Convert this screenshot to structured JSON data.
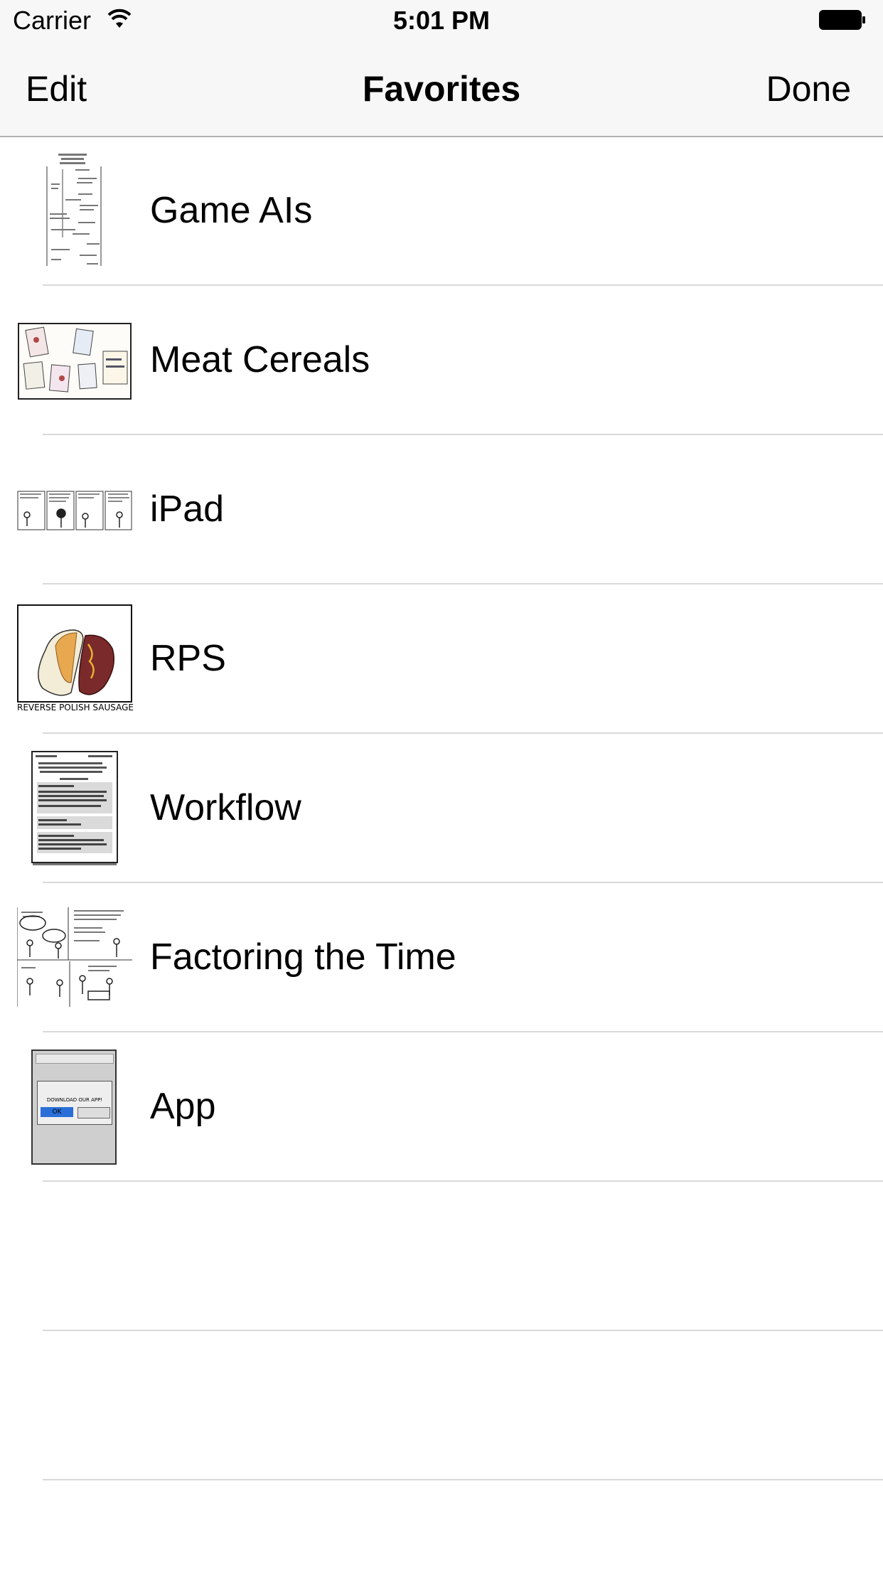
{
  "status_bar": {
    "carrier": "Carrier",
    "time": "5:01 PM"
  },
  "nav": {
    "left_button": "Edit",
    "title": "Favorites",
    "right_button": "Done"
  },
  "favorites": [
    {
      "title": "Game AIs"
    },
    {
      "title": "Meat Cereals"
    },
    {
      "title": "iPad"
    },
    {
      "title": "RPS",
      "thumb_caption": "REVERSE POLISH SAUSAGE"
    },
    {
      "title": "Workflow"
    },
    {
      "title": "Factoring the Time"
    },
    {
      "title": "App",
      "thumb_caption": "DOWNLOAD OUR APP!",
      "thumb_button": "OK"
    }
  ],
  "colors": {
    "bar_background": "#f7f7f7",
    "separator": "#d9d9d9",
    "text": "#000000"
  }
}
